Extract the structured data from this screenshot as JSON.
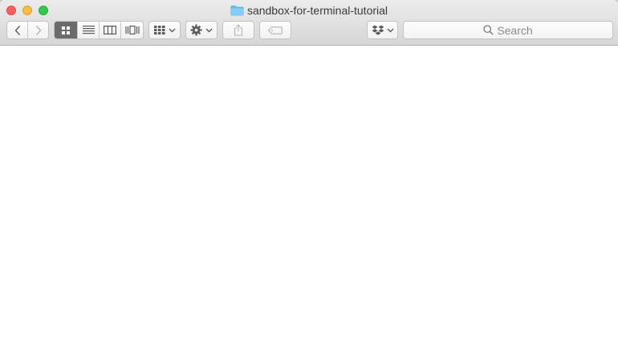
{
  "window": {
    "title": "sandbox-for-terminal-tutorial",
    "folder_color": "#6bbff2"
  },
  "toolbar": {
    "back_icon": "chevron-left-icon",
    "forward_icon": "chevron-right-icon",
    "view_modes": [
      "icon-view",
      "list-view",
      "column-view",
      "cover-flow-view"
    ],
    "active_view": "icon-view",
    "arrange_icon": "grid-arrange-icon",
    "action_icon": "gear-icon",
    "share_icon": "share-icon",
    "tag_icon": "tag-icon",
    "dropbox_icon": "dropbox-icon"
  },
  "search": {
    "placeholder": "Search"
  }
}
